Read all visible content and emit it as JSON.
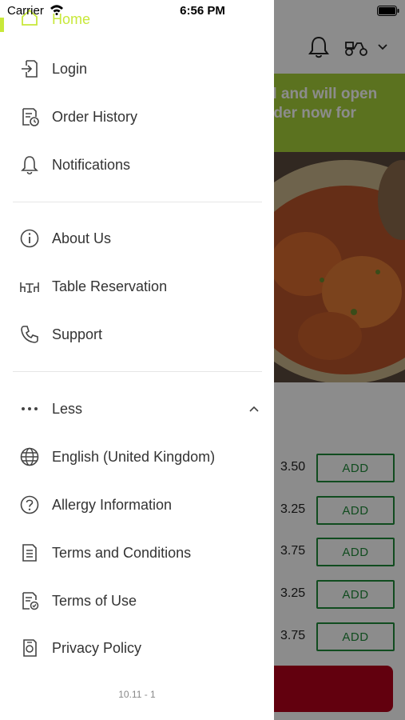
{
  "status_bar": {
    "carrier": "Carrier",
    "time": "6:56 PM"
  },
  "drawer": {
    "home_label": "Home",
    "section1": [
      {
        "label": "Login",
        "icon": "login-icon"
      },
      {
        "label": "Order History",
        "icon": "order-history-icon"
      },
      {
        "label": "Notifications",
        "icon": "bell-icon"
      }
    ],
    "section2": [
      {
        "label": "About Us",
        "icon": "info-icon"
      },
      {
        "label": "Table Reservation",
        "icon": "table-icon"
      },
      {
        "label": "Support",
        "icon": "phone-icon"
      }
    ],
    "section3": [
      {
        "label": "Less",
        "icon": "more-dots-icon"
      },
      {
        "label": "English (United Kingdom)",
        "icon": "globe-icon"
      },
      {
        "label": "Allergy Information",
        "icon": "question-icon"
      },
      {
        "label": "Terms and Conditions",
        "icon": "document-icon"
      },
      {
        "label": "Terms of Use",
        "icon": "document-check-icon"
      },
      {
        "label": "Privacy Policy",
        "icon": "privacy-icon"
      }
    ],
    "version": "10.11 - 1"
  },
  "background": {
    "banner_text_line1": "d and will open",
    "banner_text_line2": "rder now for",
    "menu_rows": [
      {
        "price": "3.50",
        "button": "ADD"
      },
      {
        "price": "3.25",
        "button": "ADD"
      },
      {
        "price": "3.75",
        "button": "ADD"
      },
      {
        "price": "3.25",
        "button": "ADD"
      },
      {
        "price": "3.75",
        "button": "ADD"
      }
    ]
  },
  "colors": {
    "accent": "#c8e83a",
    "banner": "#a6cf3a",
    "add_green": "#1f8a3a",
    "basket_red": "#b3001b"
  }
}
